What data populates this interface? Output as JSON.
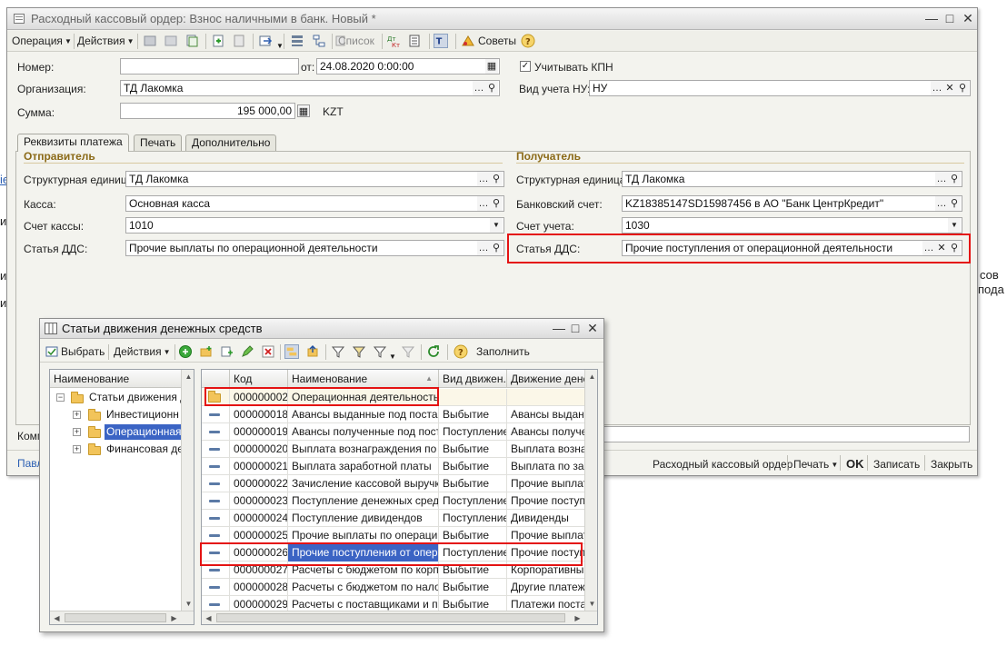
{
  "background": {
    "left_fragments": [
      "ie",
      "и",
      "ие",
      "ие"
    ],
    "right_fragments": [
      "сов",
      "пода"
    ]
  },
  "window": {
    "title": "Расходный кассовый ордер: Взнос наличными в банк. Новый *",
    "toolbar": {
      "operation": "Операция",
      "actions": "Действия",
      "list": "Список",
      "advice": "Советы"
    },
    "header": {
      "number_label": "Номер:",
      "number_value": "",
      "date_label": "от:",
      "date_value": "24.08.2020  0:00:00",
      "kpn_label": "Учитывать КПН",
      "kpn_checked": true,
      "org_label": "Организация:",
      "org_value": "ТД Лакомка",
      "nu_label": "Вид учета НУ:",
      "nu_value": "НУ",
      "sum_label": "Сумма:",
      "sum_value": "195 000,00",
      "currency": "KZT"
    },
    "tabs": [
      "Реквизиты платежа",
      "Печать",
      "Дополнительно"
    ],
    "sender": {
      "title": "Отправитель",
      "unit_label": "Структурная единица:",
      "unit_value": "ТД Лакомка",
      "cash_label": "Касса:",
      "cash_value": "Основная касса",
      "account_label": "Счет кассы:",
      "account_value": "1010",
      "dds_label": "Статья ДДС:",
      "dds_value": "Прочие выплаты по операционной деятельности"
    },
    "receiver": {
      "title": "Получатель",
      "unit_label": "Структурная единица:",
      "unit_value": "ТД Лакомка",
      "bank_label": "Банковский счет:",
      "bank_value": "KZ18385147SD15987456 в АО \"Банк ЦентрКредит\"",
      "account_label": "Счет учета:",
      "account_value": "1030",
      "dds_label": "Статья ДДС:",
      "dds_value": "Прочие поступления от операционной деятельности"
    },
    "comment_label": "Комм",
    "responsible_label": "Павл",
    "footer": {
      "print_form": "Расходный кассовый ордер",
      "print": "Печать",
      "ok": "OK",
      "save": "Записать",
      "close": "Закрыть"
    }
  },
  "dialog": {
    "title": "Статьи движения денежных средств",
    "toolbar": {
      "select": "Выбрать",
      "actions": "Действия",
      "fill": "Заполнить"
    },
    "tree": {
      "header": "Наименование",
      "items": [
        {
          "label": "Статьи движения д",
          "level": 0
        },
        {
          "label": "Инвестиционн",
          "level": 1
        },
        {
          "label": "Операционная д",
          "level": 1,
          "selected": true
        },
        {
          "label": "Финансовая де",
          "level": 1
        }
      ]
    },
    "table": {
      "headers": [
        "Код",
        "Наименование",
        "Вид движен...",
        "Движение дене"
      ],
      "rows": [
        {
          "code": "000000002",
          "name": "Операционная деятельность",
          "kind": "",
          "move": "",
          "folder": true
        },
        {
          "code": "000000018",
          "name": "Авансы выданные под поста...",
          "kind": "Выбытие",
          "move": "Авансы выданн"
        },
        {
          "code": "000000019",
          "name": "Авансы полученные под пост...",
          "kind": "Поступление",
          "move": "Авансы получе"
        },
        {
          "code": "000000020",
          "name": "Выплата вознаграждения по ...",
          "kind": "Выбытие",
          "move": "Выплата возна"
        },
        {
          "code": "000000021",
          "name": "Выплата заработной платы",
          "kind": "Выбытие",
          "move": "Выплата по зар"
        },
        {
          "code": "000000022",
          "name": "Зачисление кассовой выручк...",
          "kind": "Выбытие",
          "move": "Прочие выплат"
        },
        {
          "code": "000000023",
          "name": "Поступление денежных сред...",
          "kind": "Поступление",
          "move": "Прочие поступл"
        },
        {
          "code": "000000024",
          "name": "Поступление дивидендов",
          "kind": "Поступление",
          "move": "Дивиденды"
        },
        {
          "code": "000000025",
          "name": "Прочие выплаты по операци...",
          "kind": "Выбытие",
          "move": "Прочие выплат"
        },
        {
          "code": "000000026",
          "name": "Прочие поступления от опер...",
          "kind": "Поступление",
          "move": "Прочие поступл",
          "selected": true
        },
        {
          "code": "000000027",
          "name": "Расчеты с бюджетом по корп...",
          "kind": "Выбытие",
          "move": "Корпоративный"
        },
        {
          "code": "000000028",
          "name": "Расчеты с бюджетом по нало...",
          "kind": "Выбытие",
          "move": "Другие платеж"
        },
        {
          "code": "000000029",
          "name": "Расчеты с поставщиками и п...",
          "kind": "Выбытие",
          "move": "Платежи постав"
        }
      ]
    }
  }
}
